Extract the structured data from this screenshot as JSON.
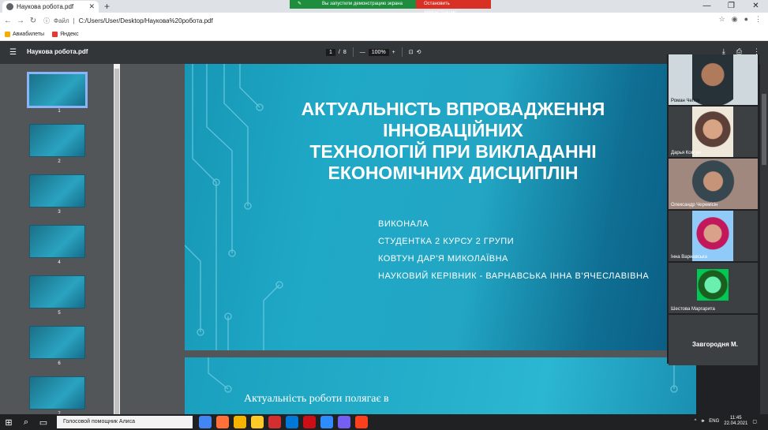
{
  "browser": {
    "tab_title": "Наукова робота.pdf",
    "new_tab": "+",
    "window_controls": [
      "—",
      "❐",
      "✕"
    ],
    "share_message": "Вы запустили демонстрацию экрана",
    "share_stop": "Остановить демонстрацию",
    "address_label": "Файл",
    "url": "C:/Users/User/Desktop/Наукова%20робота.pdf",
    "bookmarks": [
      "Авиабилеты",
      "Яндекс"
    ]
  },
  "pdf": {
    "title": "Наукова робота.pdf",
    "page_current": "1",
    "page_sep": "/",
    "page_total": "8",
    "zoom": "100%",
    "zoom_minus": "—",
    "zoom_plus": "+"
  },
  "thumbnails": [
    {
      "n": "1"
    },
    {
      "n": "2"
    },
    {
      "n": "3"
    },
    {
      "n": "4"
    },
    {
      "n": "5"
    },
    {
      "n": "6"
    },
    {
      "n": "7"
    }
  ],
  "slide1": {
    "title_lines": [
      "АКТУАЛЬНІСТЬ ВПРОВАДЖЕННЯ",
      "ІННОВАЦІЙНИХ",
      "ТЕХНОЛОГІЙ ПРИ ВИКЛАДАННІ",
      "ЕКОНОМІЧНИХ ДИСЦИПЛІН"
    ],
    "info": [
      "ВИКОНАЛА",
      "СТУДЕНТКА 2 КУРСУ 2 ГРУПИ",
      "КОВТУН ДАР'Я МИКОЛАЇВНА",
      "НАУКОВИЙ КЕРІВНИК - ВАРНАВСЬКА ІННА В'ЯЧЕСЛАВІВНА"
    ]
  },
  "slide2": {
    "text": "Актуальність роботи полягає в"
  },
  "participants": [
    {
      "name": "Роман Чепок"
    },
    {
      "name": "Дарья Ковтун"
    },
    {
      "name": "Олександр Черемісін"
    },
    {
      "name": "Інна Варнавська"
    },
    {
      "name": "Шестова Маргарита"
    },
    {
      "name": "Завгородня М."
    }
  ],
  "taskbar": {
    "search": "Голосовой помощник Алиса",
    "lang": "ENG",
    "time": "11:45",
    "date": "22.04.2021"
  }
}
